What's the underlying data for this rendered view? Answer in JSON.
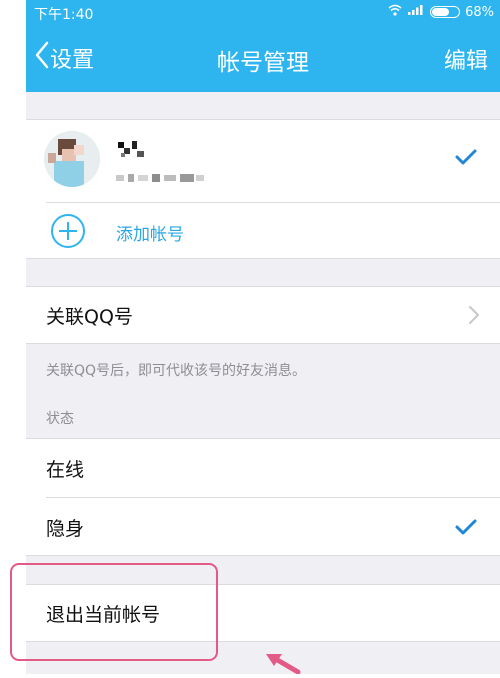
{
  "status_bar": {
    "time": "下午1:40",
    "battery": "68%",
    "battery_level": 0.68
  },
  "nav": {
    "back_label": "设置",
    "title": "帐号管理",
    "edit_label": "编辑"
  },
  "account": {
    "add_label": "添加帐号"
  },
  "link_qq": {
    "label": "关联QQ号",
    "hint": "关联QQ号后，即可代收该号的好友消息。"
  },
  "status": {
    "header": "状态",
    "options": [
      {
        "label": "在线",
        "selected": false
      },
      {
        "label": "隐身",
        "selected": true
      }
    ]
  },
  "logout": {
    "label": "退出当前帐号"
  },
  "colors": {
    "accent": "#2eb5f0",
    "check": "#1f86d8",
    "highlight": "#e25a86"
  }
}
